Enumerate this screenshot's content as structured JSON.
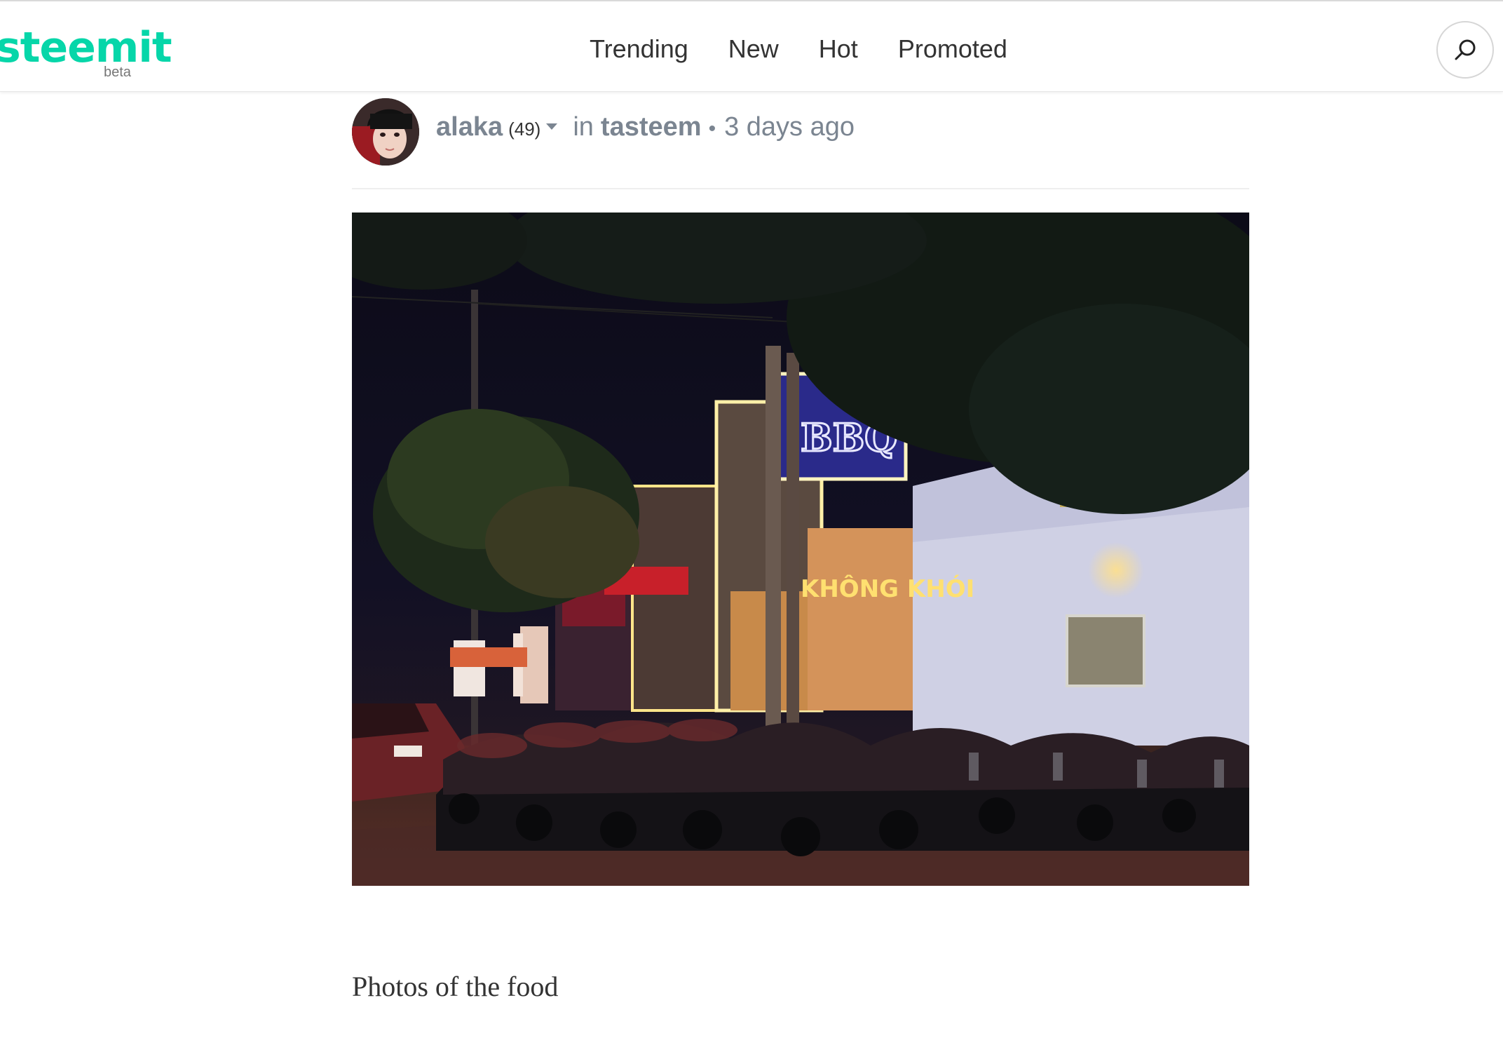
{
  "header": {
    "logo": "steemit",
    "logo_badge": "beta",
    "nav": [
      {
        "label": "Trending"
      },
      {
        "label": "New"
      },
      {
        "label": "Hot"
      },
      {
        "label": "Promoted"
      }
    ],
    "search_icon": "search-icon"
  },
  "post": {
    "author": "alaka",
    "reputation": "(49)",
    "in_label": "in",
    "category": "tasteem",
    "separator": "•",
    "time": "3 days ago",
    "image_signs": {
      "bbq": "BBQ",
      "khong_khoi": "KHÔNG KHÓI"
    },
    "body": "Photos of the food"
  },
  "colors": {
    "brand": "#06d6a9",
    "meta_text": "#7b8591",
    "body_text": "#333333"
  }
}
